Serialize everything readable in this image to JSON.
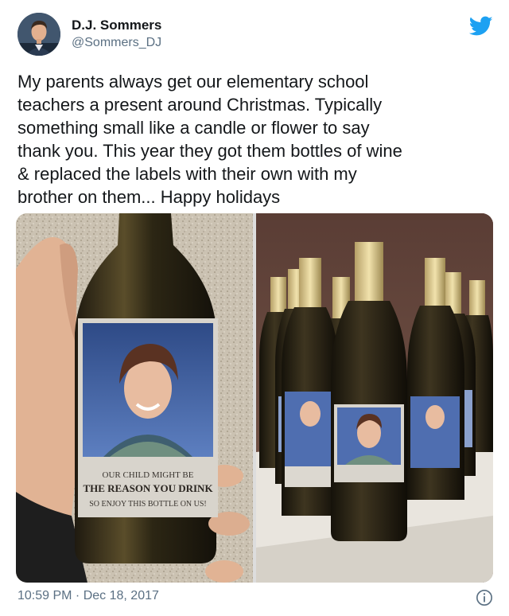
{
  "author": {
    "display_name": "D.J. Sommers",
    "handle": "@Sommers_DJ"
  },
  "tweet": {
    "lines": [
      "My parents always get our elementary school",
      "teachers a present around Christmas. Typically",
      "something small like a candle or flower to say",
      "thank you. This year they got them bottles of wine",
      "& replaced the labels with their own with my",
      "brother on them... Happy holidays"
    ]
  },
  "media": {
    "label_line_1": "OUR CHILD MIGHT BE",
    "label_line_2": "THE REASON YOU DRINK",
    "label_line_3": "SO ENJOY THIS BOTTLE ON US!"
  },
  "footer": {
    "time": "10:59 PM",
    "separator": " · ",
    "date": "Dec 18, 2017"
  },
  "icons": {
    "brand": "twitter-bird-icon",
    "info": "info-icon"
  },
  "colors": {
    "twitter_blue": "#1da1f2",
    "secondary_text": "#5b7083"
  }
}
